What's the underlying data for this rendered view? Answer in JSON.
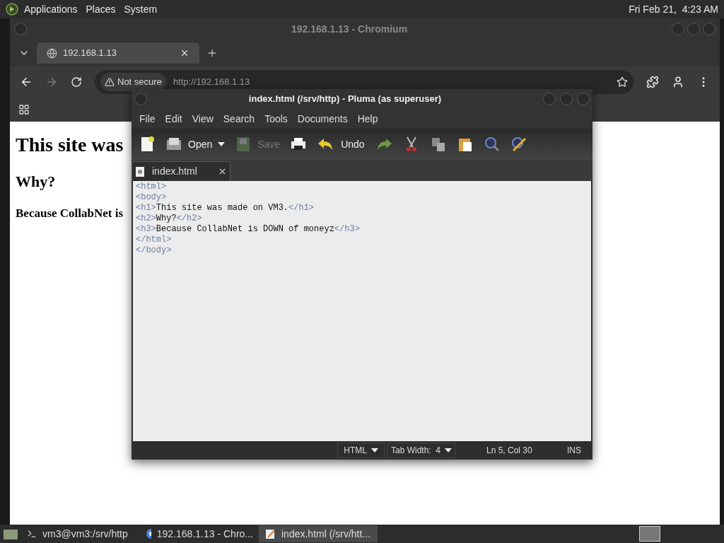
{
  "top_panel": {
    "menus": [
      "Applications",
      "Places",
      "System"
    ],
    "clock": "Fri Feb 21,  4:23 AM"
  },
  "browser": {
    "title": "192.168.1.13 - Chromium",
    "tabs": [
      {
        "label": "192.168.1.13",
        "selected": true
      }
    ],
    "address": {
      "security": "Not secure",
      "url": "http://192.168.1.13"
    },
    "page": {
      "h1": "This site was",
      "h2": "Why?",
      "h3": "Because CollabNet is"
    }
  },
  "editor": {
    "title": "index.html (/srv/http) - Pluma (as superuser)",
    "menus": [
      "File",
      "Edit",
      "View",
      "Search",
      "Tools",
      "Documents",
      "Help"
    ],
    "toolbar": [
      {
        "kind": "new",
        "disabled": false
      },
      {
        "kind": "open",
        "label": "Open",
        "disabled": false
      },
      {
        "kind": "save",
        "label": "Save",
        "disabled": true
      },
      {
        "kind": "print",
        "disabled": false
      },
      {
        "kind": "undo",
        "label": "Undo",
        "disabled": false
      },
      {
        "kind": "redo",
        "disabled": false
      },
      {
        "kind": "cut",
        "disabled": false
      },
      {
        "kind": "copy",
        "disabled": false
      },
      {
        "kind": "paste",
        "disabled": false
      },
      {
        "kind": "find",
        "disabled": false
      },
      {
        "kind": "replace",
        "disabled": false
      }
    ],
    "tabs": [
      {
        "label": "index.html",
        "selected": true
      }
    ],
    "lines": [
      [
        {
          "kind": "tag",
          "text": "<html>"
        }
      ],
      [
        {
          "kind": "tag",
          "text": "<body>"
        }
      ],
      [
        {
          "kind": "tag",
          "text": "<h1>"
        },
        {
          "kind": "text",
          "text": "This site was made on VM3."
        },
        {
          "kind": "tag",
          "text": "</h1>"
        }
      ],
      [
        {
          "kind": "tag",
          "text": "<h2>"
        },
        {
          "kind": "text",
          "text": "Why?"
        },
        {
          "kind": "tag",
          "text": "</h2>"
        }
      ],
      [
        {
          "kind": "tag",
          "text": "<h3>"
        },
        {
          "kind": "text",
          "text": "Because CollabNet is DOWN of moneyz"
        },
        {
          "kind": "tag",
          "text": "</h3>"
        }
      ],
      [
        {
          "kind": "tag",
          "text": "</html>"
        }
      ],
      [
        {
          "kind": "tag",
          "text": "</body>"
        }
      ]
    ],
    "status": {
      "language": "HTML",
      "tab_width": "Tab Width:  4",
      "position": "Ln 5, Col 30",
      "mode": "INS"
    }
  },
  "taskbar": [
    {
      "kind": "terminal",
      "label": "vm3@vm3:/srv/http",
      "selected": false
    },
    {
      "kind": "browser",
      "label": "192.168.1.13 - Chro...",
      "selected": false
    },
    {
      "kind": "editor",
      "label": "index.html (/srv/htt...",
      "selected": true
    }
  ]
}
